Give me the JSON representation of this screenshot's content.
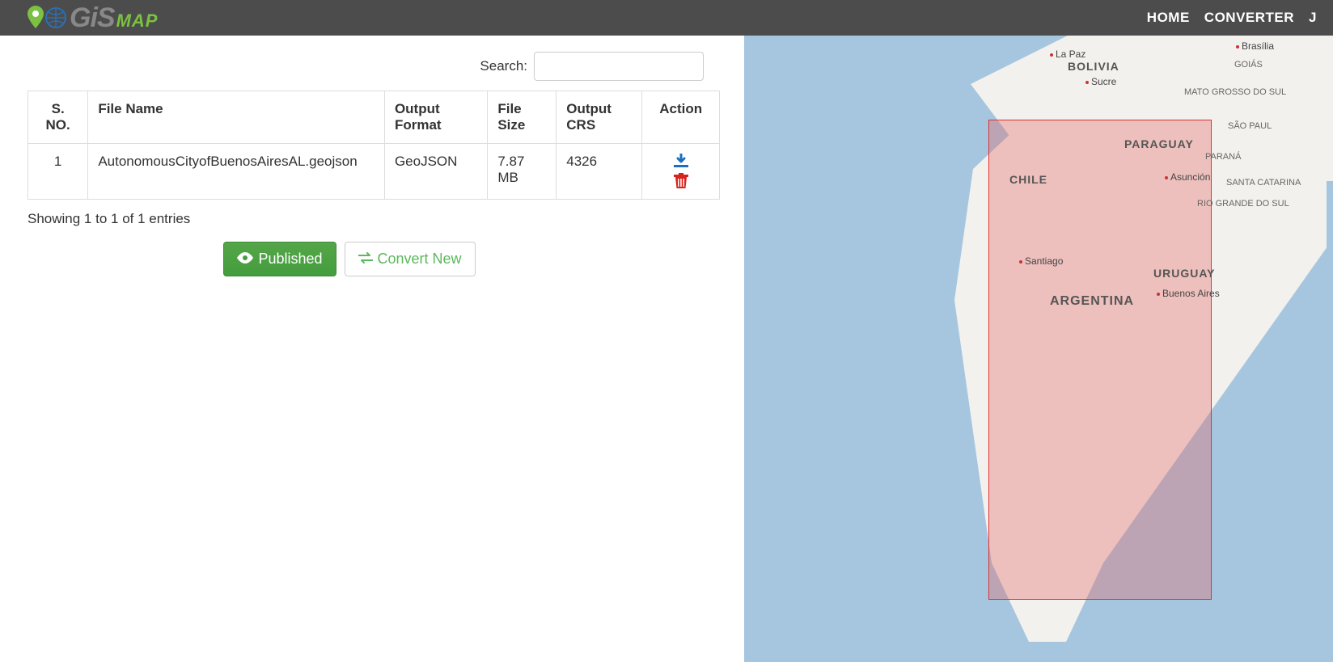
{
  "logo": {
    "gis": "GiS",
    "map": "MAP"
  },
  "nav": {
    "home": "HOME",
    "converter": "CONVERTER",
    "j": "J"
  },
  "search": {
    "label": "Search:",
    "value": ""
  },
  "table": {
    "headers": {
      "sno": "S. NO.",
      "filename": "File Name",
      "output_format": "Output Format",
      "file_size": "File Size",
      "output_crs": "Output CRS",
      "action": "Action"
    },
    "rows": [
      {
        "sno": "1",
        "filename": "AutonomousCityofBuenosAiresAL.geojson",
        "output_format": "GeoJSON",
        "file_size": "7.87 MB",
        "output_crs": "4326"
      }
    ]
  },
  "status": "Showing 1 to 1 of 1 entries",
  "buttons": {
    "published": "Published",
    "convert_new": "Convert New"
  },
  "map": {
    "labels": {
      "la_paz": "La Paz",
      "bolivia": "BOLIVIA",
      "sucre": "Sucre",
      "brasilia": "Brasília",
      "goias": "GOIÁS",
      "mato_grosso": "MATO GROSSO DO SUL",
      "sao_paul": "SÃO PAUL",
      "parana": "PARANÁ",
      "santa_catarina": "SANTA CATARINA",
      "rio_grande": "RIO GRANDE DO SUL",
      "paraguay": "PARAGUAY",
      "asuncion": "Asunción",
      "chile": "CHILE",
      "santiago": "Santiago",
      "uruguay": "URUGUAY",
      "buenos_aires": "Buenos Aires",
      "argentina": "ARGENTINA"
    }
  }
}
